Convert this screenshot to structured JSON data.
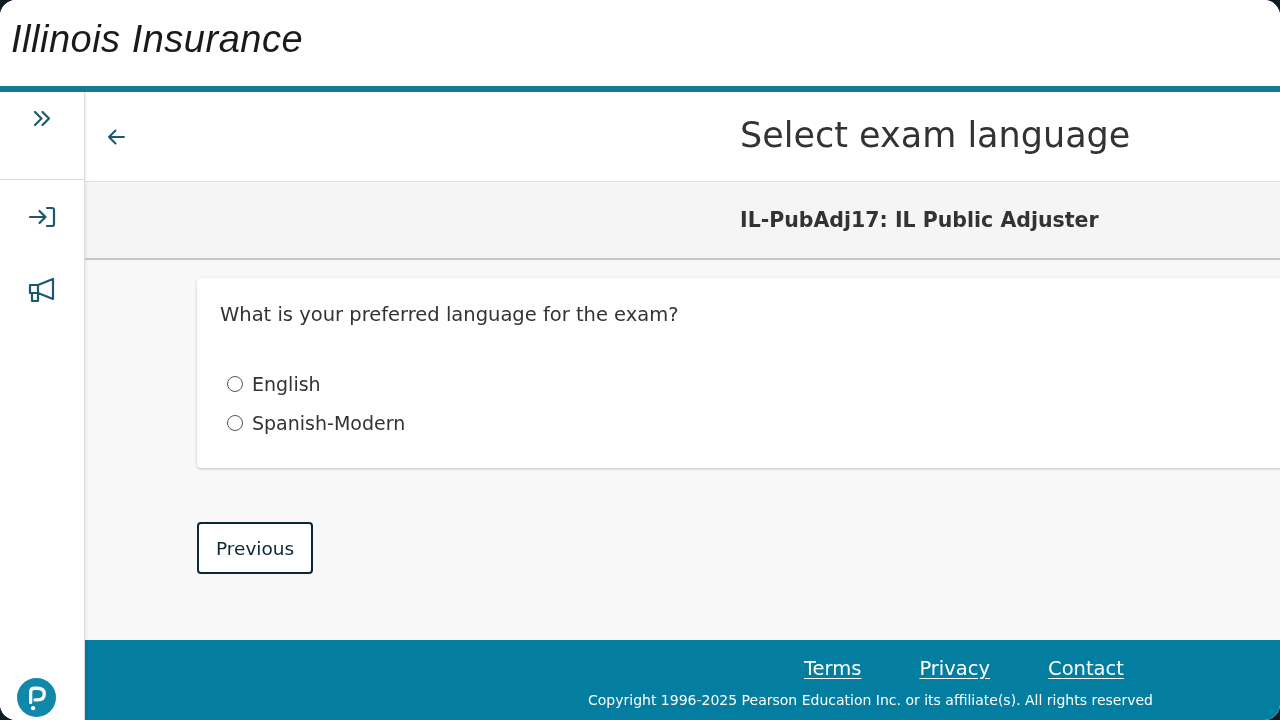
{
  "header": {
    "title": "Illinois Insurance"
  },
  "page": {
    "title": "Select exam language",
    "subtitle": "IL-PubAdj17: IL Public Adjuster"
  },
  "question": {
    "prompt": "What is your preferred language for the exam?",
    "options": [
      {
        "label": "English",
        "selected": false
      },
      {
        "label": "Spanish-Modern",
        "selected": false
      }
    ]
  },
  "buttons": [
    {
      "label": "Previous"
    }
  ],
  "footer": {
    "links": [
      "Terms",
      "Privacy",
      "Contact"
    ],
    "copyright": "Copyright 1996-2025 Pearson Education Inc. or its affiliate(s). All rights reserved"
  }
}
